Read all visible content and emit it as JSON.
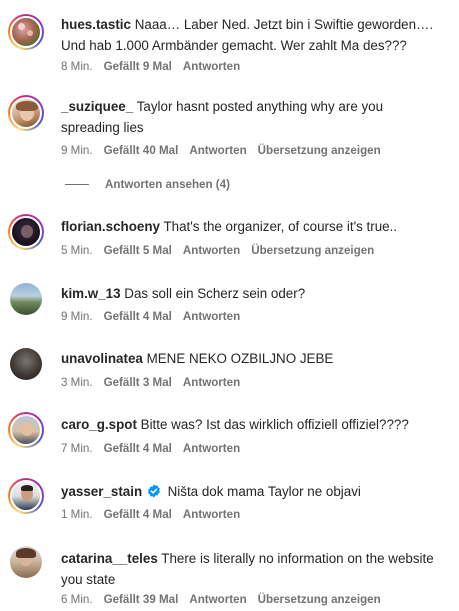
{
  "comments": [
    {
      "username": "hues.tastic",
      "text": "Naaa… Laber Ned. Jetzt bin i Swiftie geworden…. Und hab 1.000 Armbänder gemacht. Wer zahlt Ma des???",
      "time": "8 Min.",
      "likes": "Gefällt 9 Mal",
      "reply": "Antworten",
      "translate": "",
      "avatar": "floral-photo",
      "ring": true
    },
    {
      "username": "_suziquee_",
      "text": "Taylor hasnt posted anything why are you spreading lies",
      "time": "9 Min.",
      "likes": "Gefällt 40 Mal",
      "reply": "Antworten",
      "translate": "Übersetzung anzeigen",
      "avatar": "woman-photo",
      "ring": true
    },
    {
      "username": "florian.schoeny",
      "text": "That's the organizer, of course it's true..",
      "time": "5 Min.",
      "likes": "Gefällt 5 Mal",
      "reply": "Antworten",
      "translate": "Übersetzung anzeigen",
      "avatar": "dark-portrait",
      "ring": true
    },
    {
      "username": "kim.w_13",
      "text": "Das soll ein Scherz sein oder?",
      "time": "9 Min.",
      "likes": "Gefällt 4 Mal",
      "reply": "Antworten",
      "translate": "",
      "avatar": "landscape-photo",
      "ring": false
    },
    {
      "username": "unavolinatea",
      "text": "MENE NEKO OZBILJNO JEBE",
      "time": "3 Min.",
      "likes": "Gefällt 3 Mal",
      "reply": "Antworten",
      "translate": "",
      "avatar": "dark-photo",
      "ring": false
    },
    {
      "username": "caro_g.spot",
      "text": "Bitte was? Ist das wirklich offiziell offiziel????",
      "time": "7 Min.",
      "likes": "Gefällt 4 Mal",
      "reply": "Antworten",
      "translate": "",
      "avatar": "man-photo",
      "ring": true
    },
    {
      "username": "yasser_stain",
      "text": "Ništa dok mama Taylor ne objavi",
      "time": "1 Min.",
      "likes": "Gefällt 4 Mal",
      "reply": "Antworten",
      "translate": "",
      "avatar": "man-suit-photo",
      "ring": true,
      "verified": true
    },
    {
      "username": "catarina__teles",
      "text": "There is literally no information on the website you state",
      "time": "6 Min.",
      "likes": "Gefällt 39 Mal",
      "reply": "Antworten",
      "translate": "Übersetzung anzeigen",
      "avatar": "woman-photo-2",
      "ring": false
    }
  ],
  "view_replies_label": "Antworten ansehen (4)",
  "colors": {
    "text": "#262626",
    "meta": "#737373",
    "verified": "#0095f6"
  }
}
